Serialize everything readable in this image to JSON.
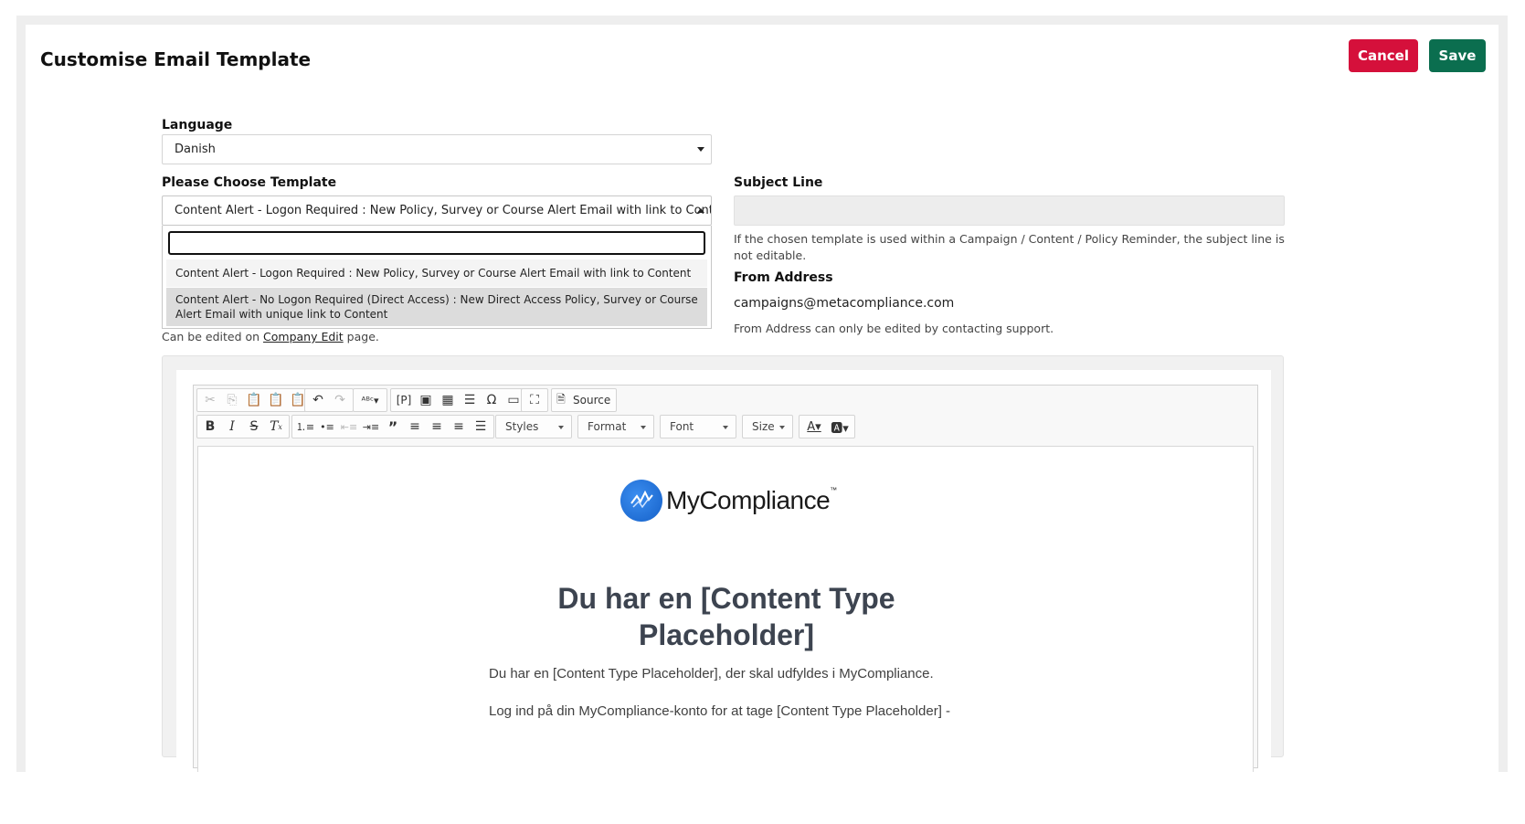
{
  "page": {
    "title": "Customise Email Template",
    "cancel_label": "Cancel",
    "save_label": "Save",
    "colors": {
      "cancel": "#d5103b",
      "save": "#0b6e4f",
      "logo": "#1560c8"
    }
  },
  "language": {
    "label": "Language",
    "value": "Danish"
  },
  "template": {
    "label": "Please Choose Template",
    "value": "Content Alert - Logon Required : New Policy, Survey or Course Alert Email with link to Content",
    "search_value": "",
    "options": [
      "Content Alert - Logon Required : New Policy, Survey or Course Alert Email with link to Content",
      "Content Alert - No Logon Required (Direct Access) : New Direct Access Policy, Survey or Course Alert Email with unique link to Content"
    ],
    "behind_prefix": "Can be edited on ",
    "behind_link": "Company Edit",
    "behind_suffix": " page."
  },
  "subject": {
    "label": "Subject Line",
    "value": "",
    "help": "If the chosen template is used within a Campaign / Content / Policy Reminder, the subject line is not editable."
  },
  "from_address": {
    "label": "From Address",
    "value": "campaigns@metacompliance.com",
    "help": "From Address can only be edited by contacting support."
  },
  "editor": {
    "source_label": "Source",
    "styles_label": "Styles",
    "format_label": "Format",
    "font_label": "Font",
    "size_label": "Size",
    "icons": [
      "cut-icon",
      "copy-icon",
      "paste-icon",
      "paste-text-icon",
      "paste-word-icon",
      "undo-icon",
      "redo-icon",
      "spellcheck-icon",
      "placeholder-icon",
      "image-icon",
      "table-icon",
      "horizontal-rule-icon",
      "special-char-icon",
      "iframe-icon",
      "maximize-icon",
      "source-icon",
      "bold-icon",
      "italic-icon",
      "strike-icon",
      "remove-format-icon",
      "numbered-list-icon",
      "bulleted-list-icon",
      "outdent-icon",
      "indent-icon",
      "blockquote-icon",
      "align-left-icon",
      "align-center-icon",
      "align-right-icon",
      "justify-icon",
      "text-color-icon",
      "bg-color-icon"
    ],
    "content": {
      "logo_text": "MyCompliance",
      "logo_tm": "™",
      "heading": "Du har en [Content Type Placeholder]",
      "paragraph1": "Du har en [Content Type Placeholder], der skal udfyldes i MyCompliance.",
      "paragraph2": "Log ind på din MyCompliance-konto for at tage [Content Type Placeholder] -"
    }
  }
}
